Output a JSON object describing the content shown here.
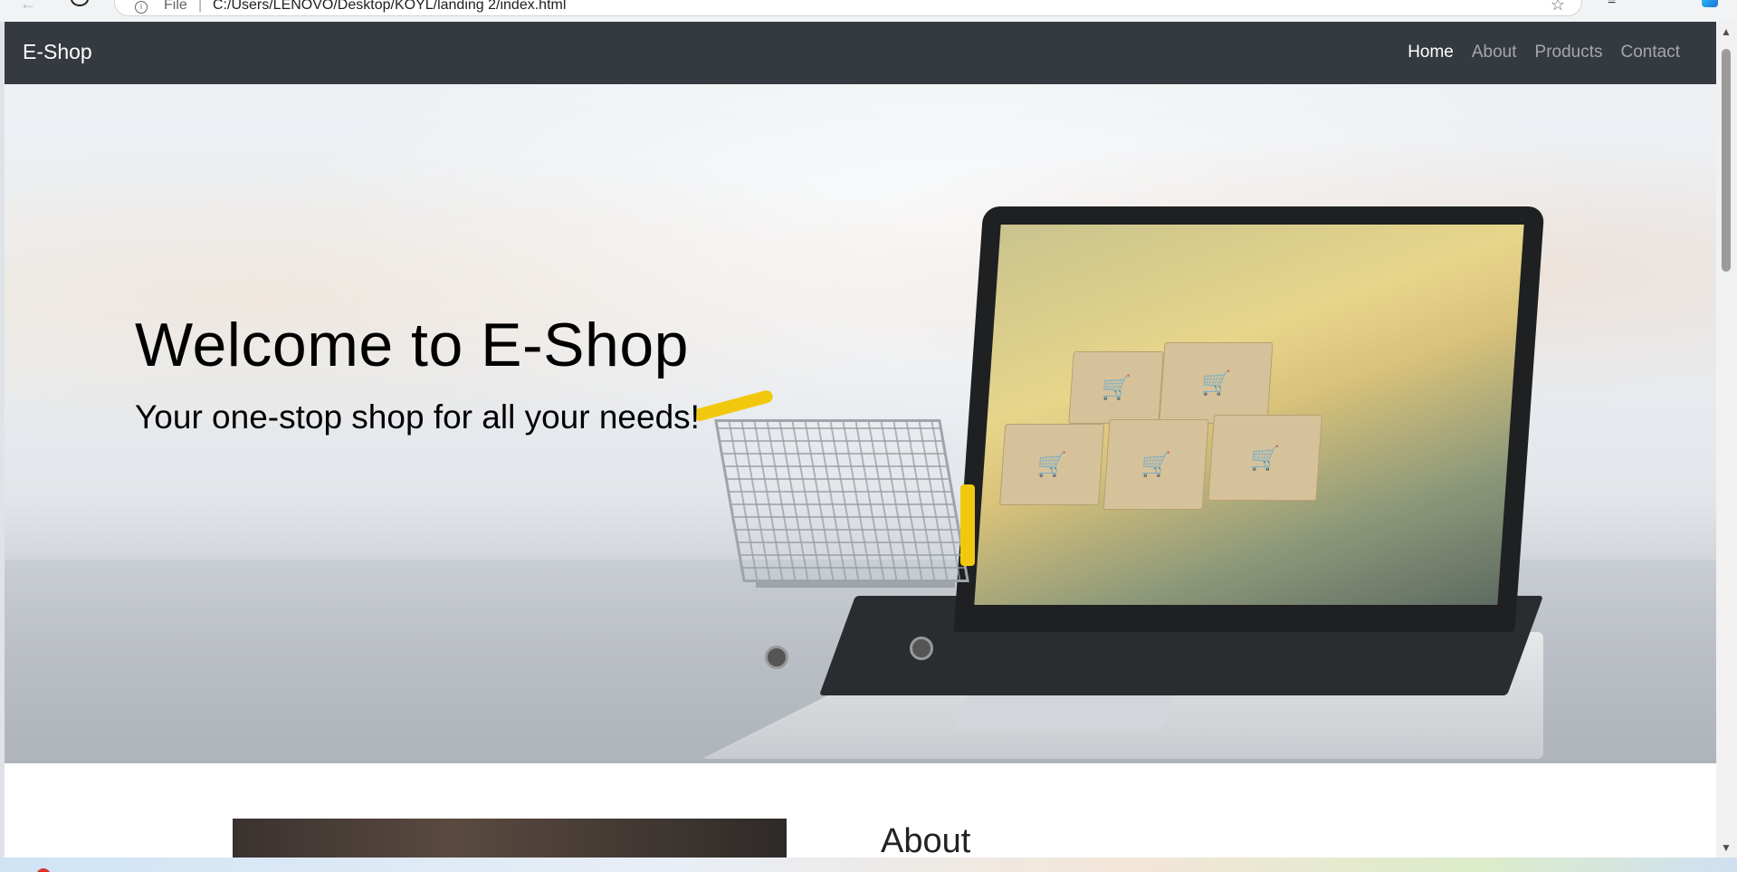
{
  "browser": {
    "url_scheme": "File",
    "url": "C:/Users/LENOVO/Desktop/KOYL/landing 2/index.html"
  },
  "navbar": {
    "brand": "E-Shop",
    "links": [
      {
        "label": "Home",
        "active": true
      },
      {
        "label": "About",
        "active": false
      },
      {
        "label": "Products",
        "active": false
      },
      {
        "label": "Contact",
        "active": false
      }
    ],
    "background": "#343a40"
  },
  "hero": {
    "title": "Welcome to E-Shop",
    "subtitle": "Your one-stop shop for all your needs!"
  },
  "about": {
    "heading": "About"
  },
  "colors": {
    "accent_yellow": "#f2c80f",
    "navbar_dark": "#343a40"
  }
}
